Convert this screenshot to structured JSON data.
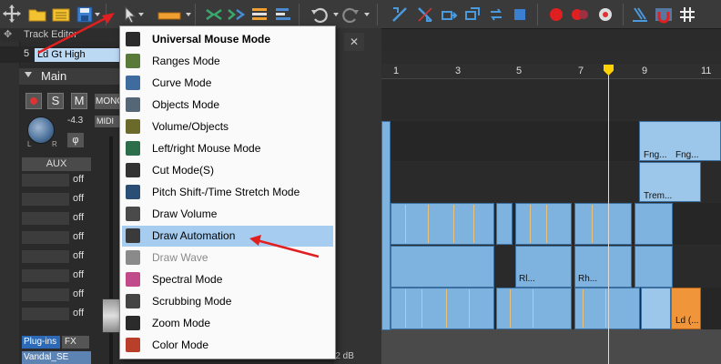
{
  "toolbar": {
    "buttons": [
      {
        "name": "expand-icon"
      },
      {
        "name": "open-folder-icon"
      },
      {
        "name": "project-icon"
      },
      {
        "name": "save-icon"
      },
      {
        "name": "mouse-mode-icon"
      },
      {
        "name": "draw-range-icon"
      },
      {
        "name": "split-icon"
      },
      {
        "name": "fx-icon"
      },
      {
        "name": "align-icon"
      },
      {
        "name": "stack-icon"
      },
      {
        "name": "undo-icon"
      },
      {
        "name": "redo-icon"
      },
      {
        "name": "snap-icon"
      },
      {
        "name": "grid-icon"
      },
      {
        "name": "move-icon"
      },
      {
        "name": "loop-icon"
      },
      {
        "name": "stop-icon"
      },
      {
        "name": "record-icon"
      },
      {
        "name": "capture-icon"
      },
      {
        "name": "settings-icon"
      },
      {
        "name": "pen-icon"
      },
      {
        "name": "magnet-icon"
      },
      {
        "name": "hash-icon"
      }
    ]
  },
  "track_editor": {
    "title": "Track Editor",
    "track_number": "5",
    "track_name": "Ld Gt High",
    "section": "Main",
    "solo": "S",
    "mute": "M",
    "mono": "MONO",
    "midi": "MIDI",
    "phase": "φ",
    "pan_value": "-4.3",
    "pan_left": "L",
    "pan_right": "R",
    "aux_label": "AUX",
    "aux_sends": [
      "off",
      "off",
      "off",
      "off",
      "off",
      "off",
      "off",
      "off",
      "off"
    ],
    "plugins_label": "Plug-ins",
    "fx_label": "FX",
    "plugin_name": "Vandal_SE"
  },
  "arrangement": {
    "ruler": [
      "1",
      "3",
      "5",
      "7",
      "9",
      "11"
    ],
    "clip_labels": [
      "Fng...",
      "Fng...",
      "Trem...",
      "Rl...",
      "Rh...",
      "Ld (..."
    ],
    "level_readout": "-2 dB"
  },
  "mouse_mode_menu": {
    "items": [
      {
        "label": "Universal Mouse Mode",
        "icon": "arrow-cursor-icon",
        "bold": true,
        "color": "#2b2b2b"
      },
      {
        "label": "Ranges Mode",
        "icon": "range-icon",
        "color": "#5a7a3a"
      },
      {
        "label": "Curve Mode",
        "icon": "curve-icon",
        "color": "#3f6b9e"
      },
      {
        "label": "Objects Mode",
        "icon": "objects-icon",
        "color": "#556677"
      },
      {
        "label": "Volume/Objects",
        "icon": "volume-objects-icon",
        "color": "#6a6a2a"
      },
      {
        "label": "Left/right Mouse Mode",
        "icon": "left-right-icon",
        "color": "#2d6e4a"
      },
      {
        "label": "Cut Mode(S)",
        "icon": "cut-icon",
        "color": "#333333"
      },
      {
        "label": "Pitch Shift-/Time Stretch Mode",
        "icon": "pitch-shift-icon",
        "color": "#2b4f74"
      },
      {
        "label": "Draw Volume",
        "icon": "draw-volume-icon",
        "color": "#4a4a4a"
      },
      {
        "label": "Draw Automation",
        "icon": "draw-automation-icon",
        "highlight": true,
        "color": "#3a3a3a"
      },
      {
        "label": "Draw Wave",
        "icon": "draw-wave-icon",
        "disabled": true,
        "color": "#8a8a8a"
      },
      {
        "label": "Spectral Mode",
        "icon": "spectral-icon",
        "color": "#c04a8a"
      },
      {
        "label": "Scrubbing Mode",
        "icon": "scrubbing-icon",
        "color": "#444444"
      },
      {
        "label": "Zoom Mode",
        "icon": "zoom-icon",
        "color": "#2b2b2b"
      },
      {
        "label": "Color Mode",
        "icon": "color-icon",
        "color": "#b8402a"
      }
    ]
  },
  "colors": {
    "menu_highlight": "#a6cdf0",
    "clip_blue": "#7fb3df",
    "clip_orange": "#f0953a",
    "playhead": "#ffd100",
    "arrow_red": "#e02020"
  }
}
